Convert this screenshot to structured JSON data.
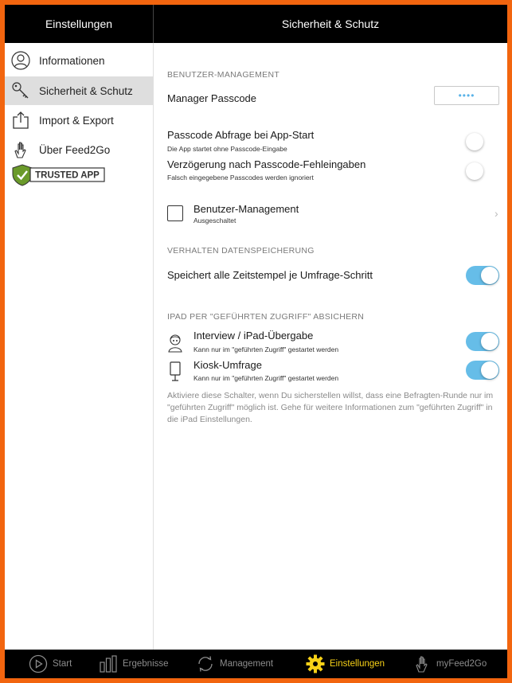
{
  "header": {
    "left_title": "Einstellungen",
    "right_title": "Sicherheit & Schutz"
  },
  "sidebar": {
    "items": [
      {
        "label": "Informationen",
        "icon": "person-circle-icon"
      },
      {
        "label": "Sicherheit & Schutz",
        "icon": "key-icon",
        "active": true
      },
      {
        "label": "Import & Export",
        "icon": "share-export-icon"
      },
      {
        "label": "Über Feed2Go",
        "icon": "hand-icon"
      }
    ],
    "badge": "TRUSTED APP"
  },
  "sections": {
    "user_management": {
      "title": "BENUTZER-MANAGEMENT",
      "manager_passcode_label": "Manager Passcode",
      "manager_passcode_value": "••••",
      "passcode_start_label": "Passcode Abfrage bei App-Start",
      "passcode_start_sub": "Die App startet ohne Passcode-Eingabe",
      "passcode_start_on": false,
      "delay_label": "Verzögerung nach Passcode-Fehleingaben",
      "delay_sub": "Falsch eingegebene Passcodes werden ignoriert",
      "delay_on": false,
      "user_mgmt_label": "Benutzer-Management",
      "user_mgmt_sub": "Ausgeschaltet"
    },
    "storage": {
      "title": "VERHALTEN DATENSPEICHERUNG",
      "timestamps_label": "Speichert alle Zeitstempel je Umfrage-Schritt",
      "timestamps_on": true
    },
    "guided_access": {
      "title": "IPAD PER \"GEFÜHRTEN ZUGRIFF\" ABSICHERN",
      "interview_label": "Interview / iPad-Übergabe",
      "interview_sub": "Kann nur im \"geführten Zugriff\" gestartet werden",
      "interview_on": true,
      "kiosk_label": "Kiosk-Umfrage",
      "kiosk_sub": "Kann nur im \"geführten Zugriff\" gestartet werden",
      "kiosk_on": true,
      "note": "Aktiviere diese Schalter, wenn Du sicherstellen willst, dass eine Befragten-Runde nur im \"geführten Zugriff\" möglich ist. Gehe für weitere Informationen zum \"geführten Zugriff\" in die iPad Einstellungen."
    }
  },
  "tabbar": {
    "tabs": [
      {
        "label": "Start",
        "icon": "play-circle-icon"
      },
      {
        "label": "Ergebnisse",
        "icon": "bar-chart-icon"
      },
      {
        "label": "Management",
        "icon": "sync-icon"
      },
      {
        "label": "Einstellungen",
        "icon": "gear-icon",
        "active": true
      },
      {
        "label": "myFeed2Go",
        "icon": "hand-icon"
      }
    ]
  },
  "colors": {
    "border_orange": "#f2650f",
    "toggle_on": "#66bde8",
    "active_tab": "#f7d117",
    "trusted_green": "#6a9a2a"
  }
}
